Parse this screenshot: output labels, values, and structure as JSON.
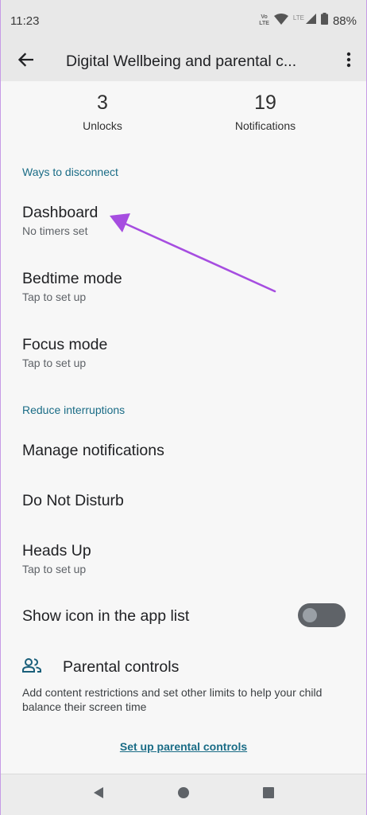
{
  "status_bar": {
    "time": "11:23",
    "volte_top": "Vo",
    "volte_bottom": "LTE",
    "lte_label": "LTE",
    "battery": "88%"
  },
  "app_bar": {
    "title": "Digital Wellbeing and parental c...",
    "back_icon": "arrow-back-icon",
    "more_icon": "more-vert-icon"
  },
  "stats": {
    "unlocks_value": "3",
    "unlocks_label": "Unlocks",
    "notifications_value": "19",
    "notifications_label": "Notifications"
  },
  "ways_to_disconnect": {
    "header": "Ways to disconnect",
    "items": [
      {
        "title": "Dashboard",
        "subtitle": "No timers set"
      },
      {
        "title": "Bedtime mode",
        "subtitle": "Tap to set up"
      },
      {
        "title": "Focus mode",
        "subtitle": "Tap to set up"
      }
    ]
  },
  "reduce_interruptions": {
    "header": "Reduce interruptions",
    "items": [
      {
        "title": "Manage notifications"
      },
      {
        "title": "Do Not Disturb"
      },
      {
        "title": "Heads Up",
        "subtitle": "Tap to set up"
      },
      {
        "title": "Show icon in the app list",
        "toggle_on": false
      }
    ]
  },
  "parental_controls": {
    "title": "Parental controls",
    "icon": "people-icon",
    "description": "Add content restrictions and set other limits to help your child balance their screen time",
    "link": "Set up parental controls"
  },
  "colors": {
    "accent": "#1a6c86",
    "annotation_arrow": "#a64de0"
  }
}
